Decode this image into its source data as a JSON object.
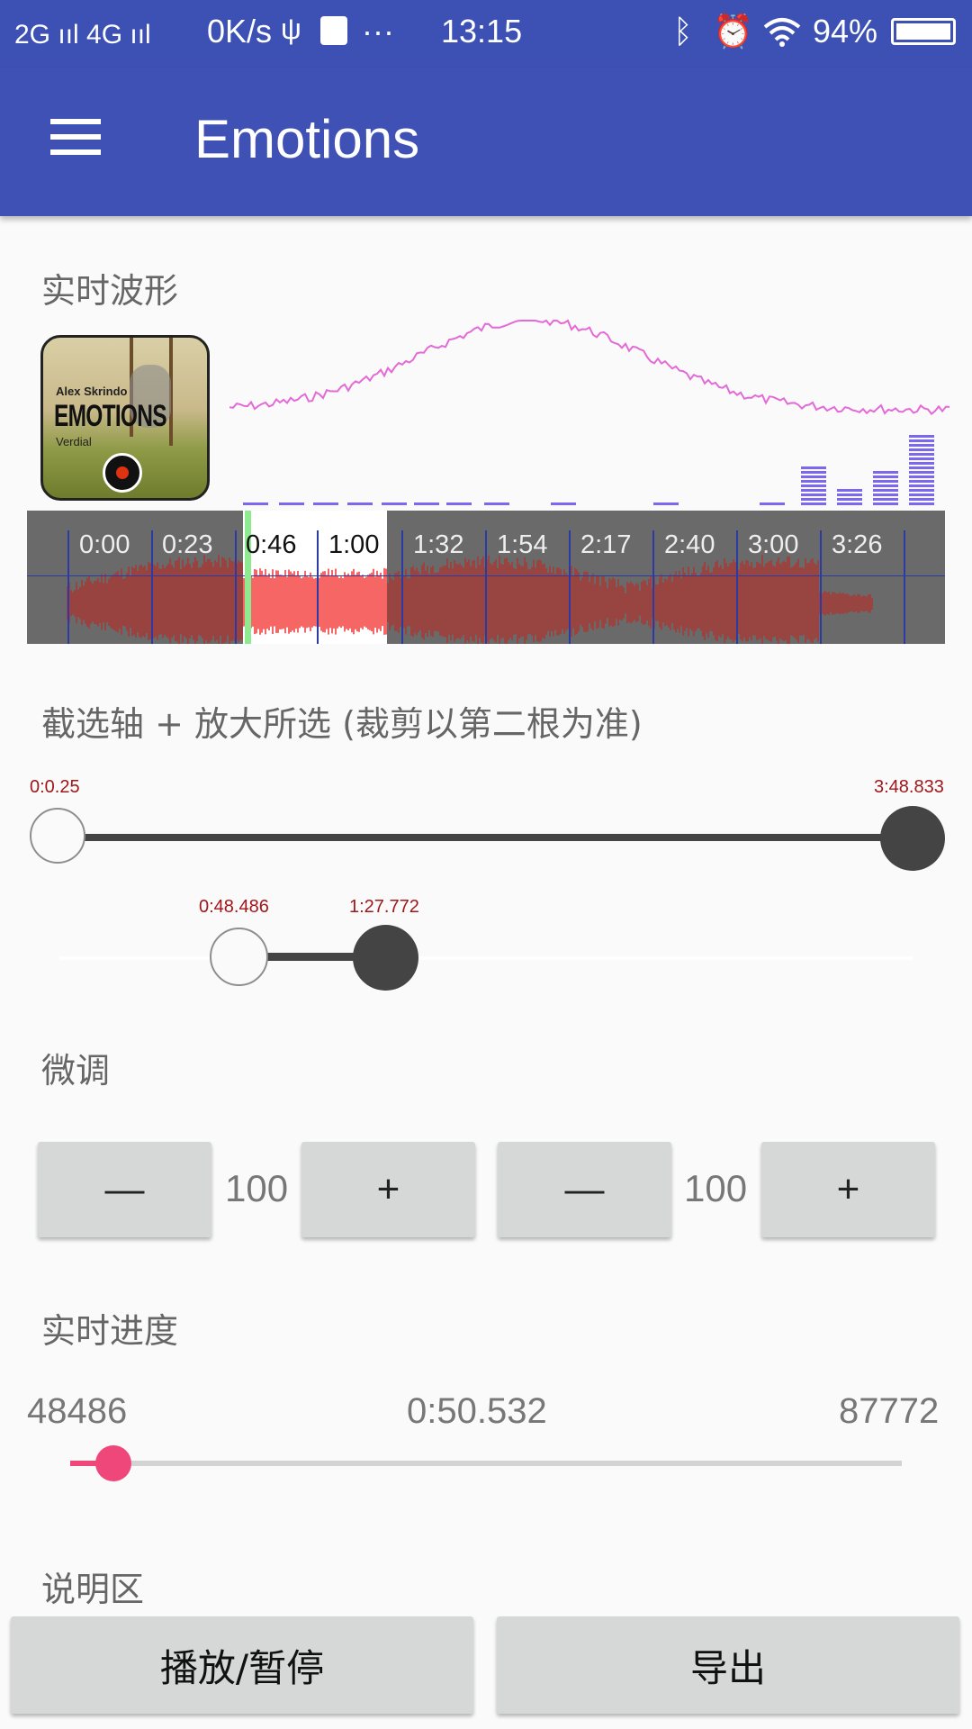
{
  "status_bar": {
    "network": "2G ııl 4G ııl",
    "speed": "0K/s",
    "icons": [
      "usb-icon",
      "usb-debug-icon",
      "more-icon"
    ],
    "time": "13:15",
    "right_icons": [
      "bluetooth-icon",
      "alarm-icon",
      "wifi-icon"
    ],
    "battery": "94%"
  },
  "app_bar": {
    "menu_icon": "hamburger-menu-icon",
    "title": "Emotions"
  },
  "waveform_section": {
    "title": "实时波形",
    "cover_art": {
      "artist": "Alex Skrindo",
      "album": "EMOTIONS",
      "subtitle": "Verdial"
    }
  },
  "timeline": {
    "labels": [
      "0:00",
      "0:23",
      "0:46",
      "1:00",
      "1:32",
      "1:54",
      "2:17",
      "2:40",
      "3:00",
      "3:26"
    ]
  },
  "range_section": {
    "title": "截选轴 + 放大所选  (裁剪以第二根为准)",
    "outer_range": {
      "start_label": "0:0.25",
      "end_label": "3:48.833"
    },
    "inner_range": {
      "start_label": "0:48.486",
      "end_label": "1:27.772"
    }
  },
  "fine_tune": {
    "title": "微调",
    "left": {
      "minus": "—",
      "value": "100",
      "plus": "+"
    },
    "right": {
      "minus": "—",
      "value": "100",
      "plus": "+"
    }
  },
  "progress": {
    "title": "实时进度",
    "start": "48486",
    "current": "0:50.532",
    "end": "87772",
    "fraction": 0.052
  },
  "notes": {
    "title": "说明区"
  },
  "actions": {
    "play_pause": "播放/暂停",
    "export": "导出"
  },
  "colors": {
    "app_bar": "#3f51b5",
    "waveform": "#a33a36",
    "waveform_selected": "#f4403e",
    "spectrum": "#7b68ee",
    "curve": "#e36ad8",
    "progress_accent": "#f0477b"
  }
}
